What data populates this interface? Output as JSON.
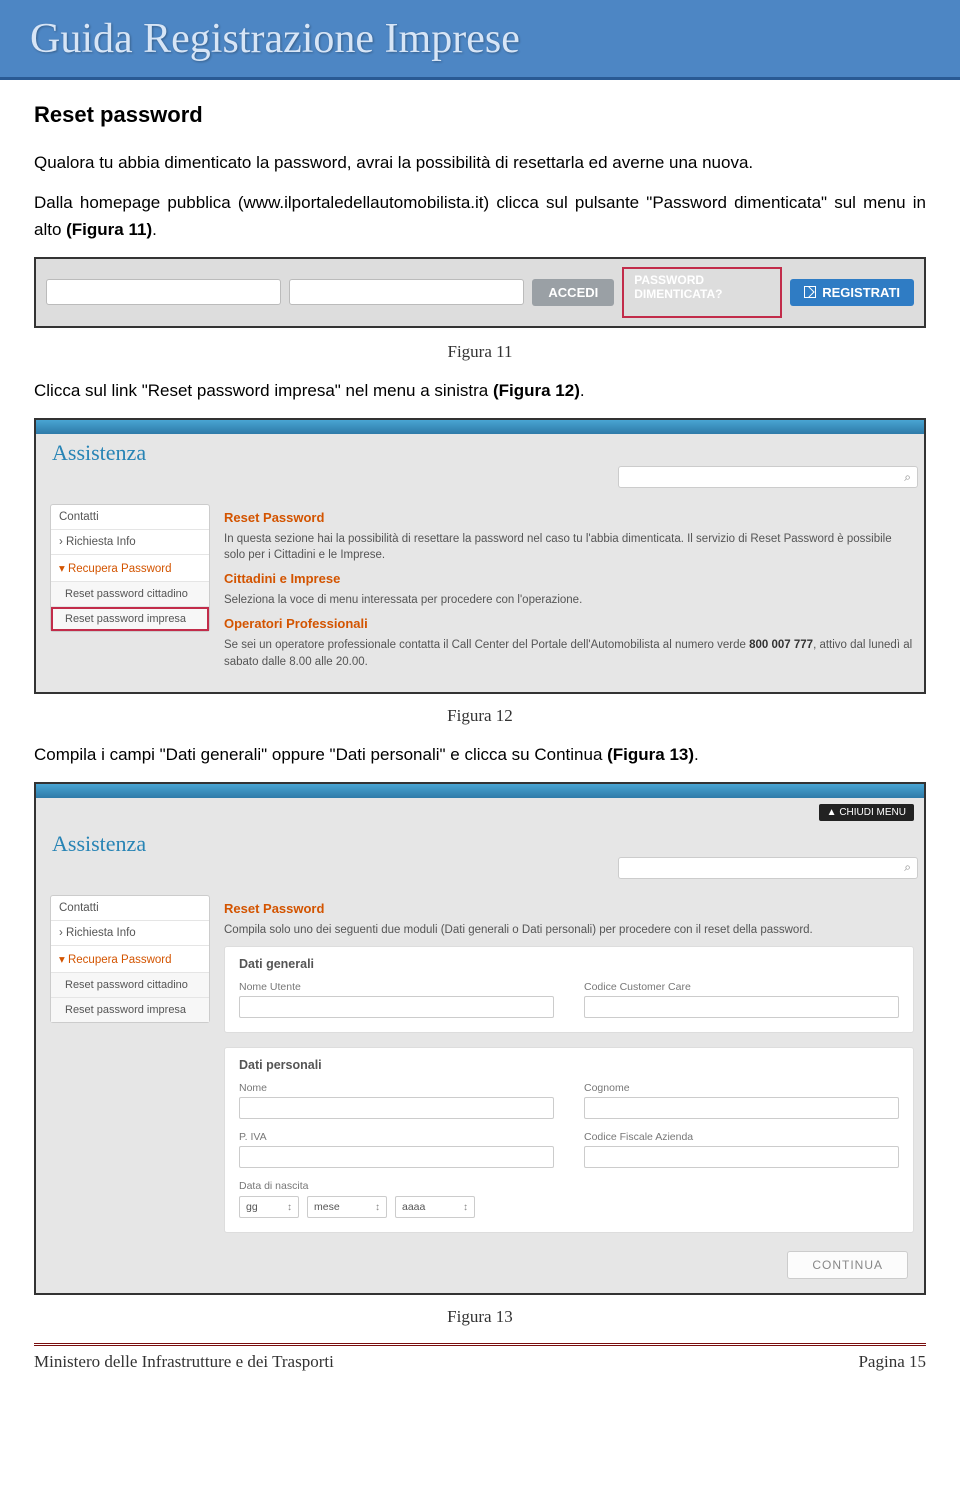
{
  "banner": {
    "title": "Guida Registrazione Imprese"
  },
  "section": {
    "title": "Reset password"
  },
  "p1": {
    "text": "Qualora tu abbia dimenticato la password, avrai la possibilità di resettarla ed averne una nuova."
  },
  "p2": {
    "prefix": "Dalla homepage pubblica (",
    "url": "www.ilportaledellautomobilista.it",
    "mid": ") clicca sul pulsante \"Password dimenticata\" sul menu in alto ",
    "ref": "(Figura 11)",
    "suffix": "."
  },
  "fig11": {
    "accedi": "ACCEDI",
    "pwd_line1": "PASSWORD",
    "pwd_line2": "DIMENTICATA?",
    "registrati": "REGISTRATI",
    "caption": "Figura 11"
  },
  "p3": {
    "prefix": "Clicca sul link \"Reset password impresa\" nel menu a sinistra  ",
    "ref": "(Figura 12)",
    "suffix": "."
  },
  "fig12": {
    "assistenza": "Assistenza",
    "side": {
      "contatti": "Contatti",
      "richiesta": "Richiesta Info",
      "recupera": "Recupera Password",
      "reset_citt": "Reset password cittadino",
      "reset_imp": "Reset password impresa"
    },
    "main": {
      "title": "Reset Password",
      "p1": "In questa sezione hai la possibilità di resettare la password nel caso tu l'abbia dimenticata. Il servizio di Reset Password è possibile solo per i Cittadini e le Imprese.",
      "h2": "Cittadini e Imprese",
      "p2": "Seleziona la voce di menu interessata per procedere con l'operazione.",
      "h3": "Operatori Professionali",
      "p3a": "Se sei un operatore professionale contatta il Call Center del Portale dell'Automobilista al numero verde ",
      "p3b": "800 007 777",
      "p3c": ", attivo dal lunedì al sabato dalle 8.00 alle 20.00."
    },
    "caption": "Figura 12"
  },
  "p4": {
    "prefix": "Compila i campi \"Dati generali\" oppure \"Dati personali\" e clicca su Continua  ",
    "ref": "(Figura 13)",
    "suffix": "."
  },
  "fig13": {
    "chiudi": "▲  CHIUDI MENU",
    "assistenza": "Assistenza",
    "side": {
      "contatti": "Contatti",
      "richiesta": "Richiesta Info",
      "recupera": "Recupera Password",
      "reset_citt": "Reset password cittadino",
      "reset_imp": "Reset password impresa"
    },
    "main": {
      "title": "Reset Password",
      "p1": "Compila solo uno dei seguenti due moduli (Dati generali o Dati personali) per procedere con il reset della password.",
      "s1": {
        "title": "Dati generali",
        "f1": "Nome Utente",
        "f2": "Codice Customer Care"
      },
      "s2": {
        "title": "Dati personali",
        "f1": "Nome",
        "f2": "Cognome",
        "f3": "P. IVA",
        "f4": "Codice Fiscale Azienda",
        "f5": "Data di nascita",
        "dob": {
          "g": "gg",
          "m": "mese",
          "a": "aaaa"
        }
      },
      "continua": "CONTINUA"
    },
    "caption": "Figura 13"
  },
  "footer": {
    "left": "Ministero delle Infrastrutture e dei Trasporti",
    "right": "Pagina 15"
  }
}
